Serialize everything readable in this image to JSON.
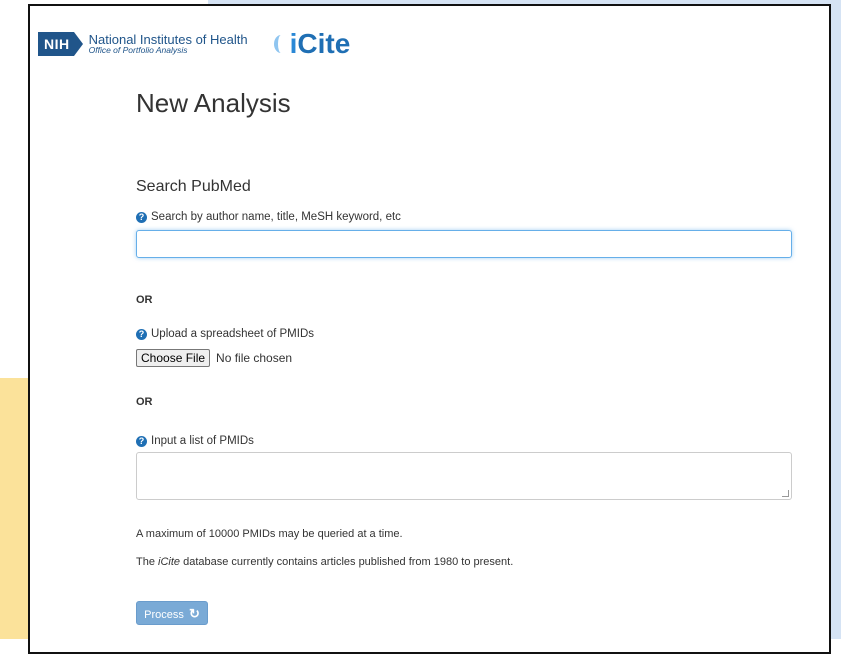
{
  "brand": {
    "nih_abbrev": "NIH",
    "nih_name": "National Institutes of Health",
    "nih_office": "Office of Portfolio Analysis",
    "icite_i": "i",
    "icite_rest": "Cite"
  },
  "page": {
    "title": "New Analysis"
  },
  "search": {
    "section_title": "Search PubMed",
    "help_text": "Search by author name, title, MeSH keyword, etc",
    "value": ""
  },
  "or_label_1": "OR",
  "upload": {
    "help_text": "Upload a spreadsheet of PMIDs",
    "button_label": "Choose File",
    "status": "No file chosen"
  },
  "or_label_2": "OR",
  "pmid_list": {
    "help_text": "Input a list of PMIDs",
    "value": ""
  },
  "notes": {
    "max_query": "A maximum of 10000 PMIDs may be queried at a time.",
    "db_prefix": "The ",
    "db_name": "iCite",
    "db_suffix": " database currently contains articles published from 1980 to present."
  },
  "process": {
    "label": "Process",
    "icon": "refresh-icon"
  },
  "colors": {
    "accent": "#1f6fb4",
    "nih_blue": "#20558a",
    "button": "#7aaad6",
    "background_blue": "#d5e3f4",
    "background_yellow": "#fbe29a"
  }
}
